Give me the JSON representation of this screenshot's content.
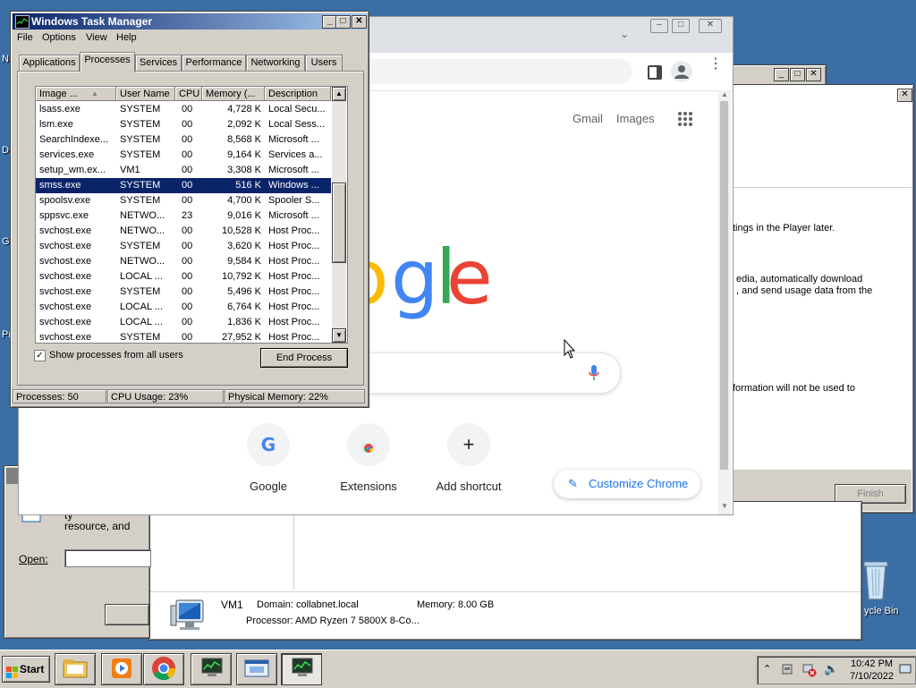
{
  "task_manager": {
    "title": "Windows Task Manager",
    "menu": [
      "File",
      "Options",
      "View",
      "Help"
    ],
    "tabs": [
      "Applications",
      "Processes",
      "Services",
      "Performance",
      "Networking",
      "Users"
    ],
    "active_tab": "Processes",
    "columns": [
      "Image ...",
      "User Name",
      "CPU",
      "Memory (...",
      "Description"
    ],
    "rows": [
      {
        "image": "lsass.exe",
        "user": "SYSTEM",
        "cpu": "00",
        "mem": "4,728 K",
        "desc": "Local Secu..."
      },
      {
        "image": "lsm.exe",
        "user": "SYSTEM",
        "cpu": "00",
        "mem": "2,092 K",
        "desc": "Local Sess..."
      },
      {
        "image": "SearchIndexe...",
        "user": "SYSTEM",
        "cpu": "00",
        "mem": "8,568 K",
        "desc": "Microsoft ..."
      },
      {
        "image": "services.exe",
        "user": "SYSTEM",
        "cpu": "00",
        "mem": "9,164 K",
        "desc": "Services a..."
      },
      {
        "image": "setup_wm.ex...",
        "user": "VM1",
        "cpu": "00",
        "mem": "3,308 K",
        "desc": "Microsoft ..."
      },
      {
        "image": "smss.exe",
        "user": "SYSTEM",
        "cpu": "00",
        "mem": "516 K",
        "desc": "Windows ..."
      },
      {
        "image": "spoolsv.exe",
        "user": "SYSTEM",
        "cpu": "00",
        "mem": "4,700 K",
        "desc": "Spooler S..."
      },
      {
        "image": "sppsvc.exe",
        "user": "NETWO...",
        "cpu": "23",
        "mem": "9,016 K",
        "desc": "Microsoft ..."
      },
      {
        "image": "svchost.exe",
        "user": "NETWO...",
        "cpu": "00",
        "mem": "10,528 K",
        "desc": "Host Proc..."
      },
      {
        "image": "svchost.exe",
        "user": "SYSTEM",
        "cpu": "00",
        "mem": "3,620 K",
        "desc": "Host Proc..."
      },
      {
        "image": "svchost.exe",
        "user": "NETWO...",
        "cpu": "00",
        "mem": "9,584 K",
        "desc": "Host Proc..."
      },
      {
        "image": "svchost.exe",
        "user": "LOCAL ...",
        "cpu": "00",
        "mem": "10,792 K",
        "desc": "Host Proc..."
      },
      {
        "image": "svchost.exe",
        "user": "SYSTEM",
        "cpu": "00",
        "mem": "5,496 K",
        "desc": "Host Proc..."
      },
      {
        "image": "svchost.exe",
        "user": "LOCAL ...",
        "cpu": "00",
        "mem": "6,764 K",
        "desc": "Host Proc..."
      },
      {
        "image": "svchost.exe",
        "user": "LOCAL ...",
        "cpu": "00",
        "mem": "1,836 K",
        "desc": "Host Proc..."
      },
      {
        "image": "svchost.exe",
        "user": "SYSTEM",
        "cpu": "00",
        "mem": "27,952 K",
        "desc": "Host Proc..."
      }
    ],
    "selected_image": "smss.exe",
    "show_all_label": "Show processes from all users",
    "show_all_checked": true,
    "end_process_label": "End Process",
    "status": {
      "processes": "Processes: 50",
      "cpu": "CPU Usage: 23%",
      "memory": "Physical Memory: 22%"
    }
  },
  "chrome": {
    "links": {
      "gmail": "Gmail",
      "images": "Images"
    },
    "logo_letters": [
      "o",
      "g",
      "l",
      "e"
    ],
    "shortcuts": [
      {
        "label": "Google",
        "icon": "google-g-icon"
      },
      {
        "label": "Extensions",
        "icon": "chrome-web-store-icon"
      },
      {
        "label": "Add shortcut",
        "icon": "plus-icon"
      }
    ],
    "customize_label": "Customize Chrome"
  },
  "setup_dialog": {
    "lines": [
      "tings in the Player later.",
      "edia, automatically download",
      ", and send usage data from the",
      "formation will not be used to"
    ],
    "finish_label": "Finish"
  },
  "run_dialog": {
    "text": "resource, and",
    "text_partial": "ty",
    "open_label": "Open:"
  },
  "computer_panel": {
    "name": "VM1",
    "domain": "Domain: collabnet.local",
    "memory": "Memory: 8.00 GB",
    "processor": "Processor: AMD Ryzen 7 5800X 8-Co..."
  },
  "desktop": {
    "recycle_bin_label": "ycle Bin",
    "edge_letters": [
      "N",
      "D",
      "G",
      "Pr"
    ]
  },
  "taskbar": {
    "start_label": "Start",
    "clock_time": "10:42 PM",
    "clock_date": "7/10/2022"
  },
  "colors": {
    "desktop": "#3a6ea5",
    "titlebar": "#0a246a",
    "selection": "#0a246a",
    "chrome_blue": "#1a73e8"
  }
}
